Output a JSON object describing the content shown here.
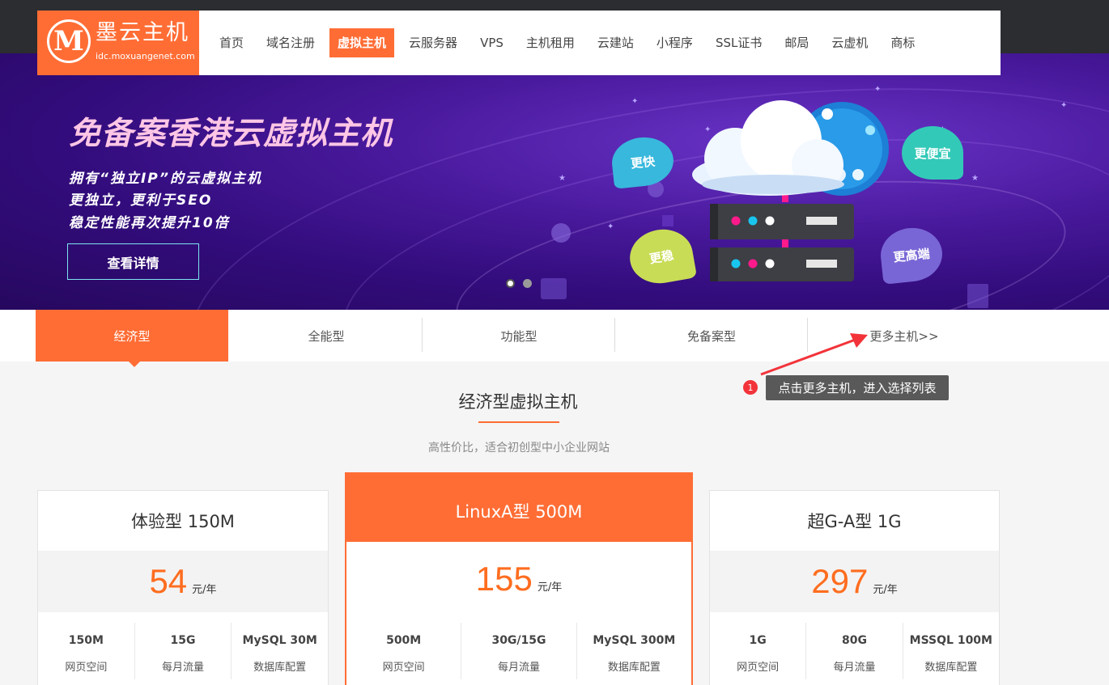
{
  "brand": {
    "logo_letter": "M",
    "name": "墨云主机",
    "url": "idc.moxuangenet.com"
  },
  "nav": {
    "items": [
      {
        "label": "首页",
        "active": false
      },
      {
        "label": "域名注册",
        "active": false
      },
      {
        "label": "虚拟主机",
        "active": true
      },
      {
        "label": "云服务器",
        "active": false
      },
      {
        "label": "VPS",
        "active": false
      },
      {
        "label": "主机租用",
        "active": false
      },
      {
        "label": "云建站",
        "active": false
      },
      {
        "label": "小程序",
        "active": false
      },
      {
        "label": "SSL证书",
        "active": false
      },
      {
        "label": "邮局",
        "active": false
      },
      {
        "label": "云虚机",
        "active": false
      },
      {
        "label": "商标",
        "active": false
      }
    ]
  },
  "banner": {
    "headline": "免备案香港云虚拟主机",
    "lines": [
      "拥有“独立IP”的云虚拟主机",
      "更独立，更利于SEO",
      "稳定性能再次提升10倍"
    ],
    "button": "查看详情",
    "bubbles": [
      "更快",
      "更便宜",
      "更稳",
      "更高端"
    ],
    "slides_total": 2,
    "slide_active": 1
  },
  "tabs": [
    {
      "label": "经济型",
      "active": true
    },
    {
      "label": "全能型",
      "active": false
    },
    {
      "label": "功能型",
      "active": false
    },
    {
      "label": "免备案型",
      "active": false
    },
    {
      "label": "更多主机>>",
      "active": false
    }
  ],
  "annotation": {
    "number": "1",
    "text": "点击更多主机，进入选择列表"
  },
  "section": {
    "title": "经济型虚拟主机",
    "subtitle": "高性价比，适合初创型中小企业网站"
  },
  "plans": [
    {
      "name": "体验型 150M",
      "price": "54",
      "unit": "元/年",
      "highlight": false,
      "specs": [
        {
          "value": "150M",
          "label": "网页空间"
        },
        {
          "value": "15G",
          "label": "每月流量"
        },
        {
          "value": "MySQL 30M",
          "label": "数据库配置"
        }
      ]
    },
    {
      "name": "LinuxA型 500M",
      "price": "155",
      "unit": "元/年",
      "highlight": true,
      "specs": [
        {
          "value": "500M",
          "label": "网页空间"
        },
        {
          "value": "30G/15G",
          "label": "每月流量"
        },
        {
          "value": "MySQL 300M",
          "label": "数据库配置"
        }
      ]
    },
    {
      "name": "超G-A型 1G",
      "price": "297",
      "unit": "元/年",
      "highlight": false,
      "specs": [
        {
          "value": "1G",
          "label": "网页空间"
        },
        {
          "value": "80G",
          "label": "每月流量"
        },
        {
          "value": "MSSQL 100M",
          "label": "数据库配置"
        }
      ]
    }
  ],
  "colors": {
    "accent": "#ff6d35",
    "price": "#ff6d1f",
    "banner": "#4a1a9e",
    "tooltip": "#595959",
    "badge": "#f2343a"
  }
}
